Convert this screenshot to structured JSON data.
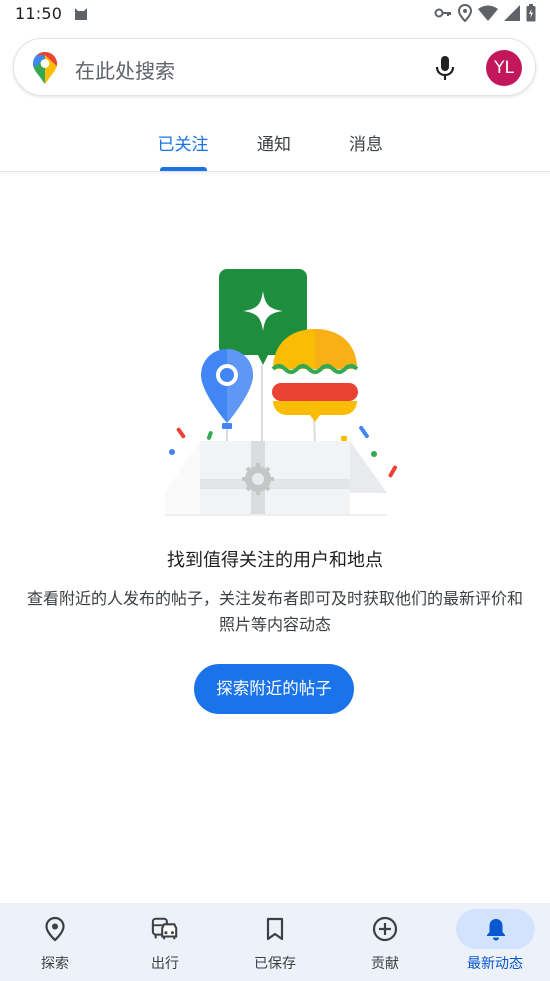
{
  "status_bar": {
    "time": "11:50",
    "icons": [
      "cat-icon",
      "key-icon",
      "location-icon",
      "wifi-icon",
      "signal-icon",
      "battery-icon"
    ]
  },
  "search": {
    "placeholder": "在此处搜索",
    "avatar_initials": "YL",
    "avatar_color": "#c2185b"
  },
  "tabs": [
    {
      "label": "已关注",
      "active": true
    },
    {
      "label": "通知",
      "active": false
    },
    {
      "label": "消息",
      "active": false
    }
  ],
  "empty_state": {
    "title": "找到值得关注的用户和地点",
    "description": "查看附近的人发布的帖子，关注发布者即可及时获取他们的最新评价和照片等内容动态",
    "button_label": "探索附近的帖子"
  },
  "bottom_nav": [
    {
      "label": "探索",
      "icon": "location-pin-icon",
      "active": false
    },
    {
      "label": "出行",
      "icon": "commute-icon",
      "active": false
    },
    {
      "label": "已保存",
      "icon": "bookmark-icon",
      "active": false
    },
    {
      "label": "贡献",
      "icon": "add-circle-icon",
      "active": false
    },
    {
      "label": "最新动态",
      "icon": "bell-icon",
      "active": true
    }
  ],
  "colors": {
    "accent": "#1a73e8",
    "nav_background": "#edf2fa",
    "nav_active_pill": "#d3e3fd"
  }
}
